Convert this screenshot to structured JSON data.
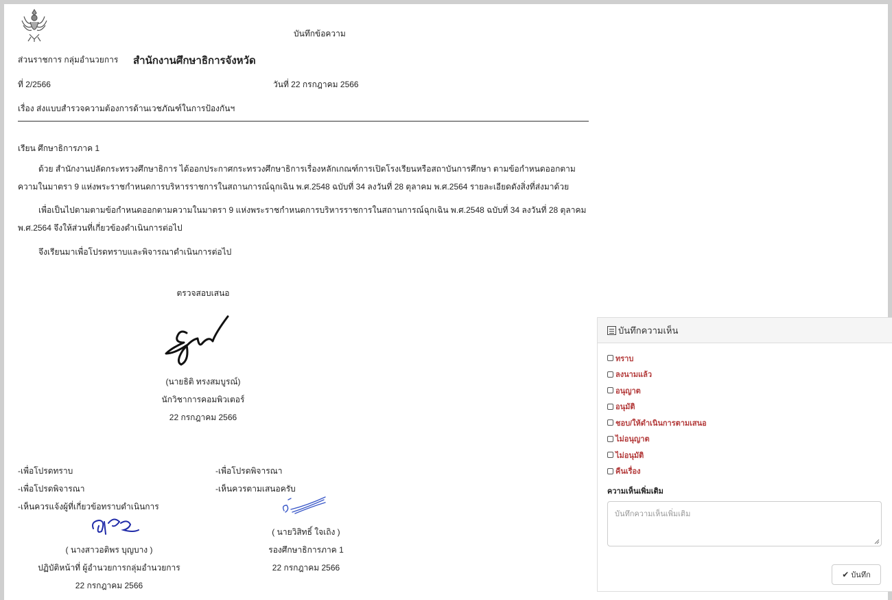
{
  "memo": {
    "title": "บันทึกข้อความ",
    "org_label": "ส่วนราชการ กลุ่มอำนวยการ",
    "org_name": "สำนักงานศึกษาธิการจังหวัด",
    "doc_no": "ที่ 2/2566",
    "doc_date": "วันที่ 22 กรกฎาคม 2566",
    "subject": "เรื่อง ส่งแบบสำรวจความต้องการด้านเวชภัณฑ์ในการป้องกันฯ",
    "to": "เรียน ศึกษาธิการภาค 1",
    "para1": "ด้วย สำนักงานปลัดกระทรวงศึกษาธิการ ได้ออกประกาศกระทรวงศึกษาธิการเรื่องหลักเกณฑ์การเปิดโรงเรียนหรือสถาบันการศึกษา ตามข้อกำหนดออกตามความในมาตรา 9 แห่งพระราชกำหนดการบริหารราชการในสถานการณ์ฉุกเฉิน พ.ศ.2548 ฉบับที่ 34 ลงวันที่ 28 ตุลาคม พ.ศ.2564 รายละเอียดดังสิ่งที่ส่งมาด้วย",
    "para2": "เพื่อเป็นไปตามตามข้อกำหนดออกตามความในมาตรา 9 แห่งพระราชกำหนดการบริหารราชการในสถานการณ์ฉุกเฉิน พ.ศ.2548 ฉบับที่ 34 ลงวันที่ 28 ตุลาคม พ.ศ.2564 จึงให้ส่วนที่เกี่ยวข้องดำเนินการต่อไป",
    "para3": "จึงเรียนมาเพื่อโปรดทราบและพิจารณาดำเนินการต่อไป"
  },
  "signer1": {
    "caption": "ตรวจสอบเสนอ",
    "name": "(นายธิติ ทรงสมบูรณ์)",
    "position": "นักวิชาการคอมพิวเตอร์",
    "date": "22 กรกฎาคม 2566"
  },
  "notes_left": [
    "-เพื่อโปรดทราบ",
    "-เพื่อโปรดพิจารณา",
    "-เห็นควรแจ้งผู้ที่เกี่ยวข้อทราบดำเนินการ"
  ],
  "signer2": {
    "name": "( นางสาวอติพร บุญบาง )",
    "position": "ปฏิบัติหน้าที่ ผู้อำนวยการกลุ่มอำนวยการ",
    "date": "22 กรกฎาคม 2566"
  },
  "notes_mid": [
    "-เพื่อโปรดพิจารณา",
    "-เห็นควรตามเสนอครับ"
  ],
  "signer3": {
    "name": "( นายวิสิทธิ์ ใจเถิง )",
    "position": "รองศึกษาธิการภาค 1",
    "date": "22 กรกฎาคม 2566"
  },
  "panel": {
    "title": "บันทึกความเห็น",
    "icon": "list-alt-icon",
    "options": [
      "ทราบ",
      "ลงนามแล้ว",
      "อนุญาต",
      "อนุมัติ",
      "ชอบ/ให้ดำเนินการตามเสนอ",
      "ไม่อนุญาต",
      "ไม่อนุมัติ",
      "คืนเรื่อง"
    ],
    "extra_label": "ความเห็นเพิ่มเติม",
    "comment_placeholder": "บันทึกความเห็นเพิ่มเติม",
    "save_label": "บันทึก"
  },
  "colors": {
    "option_text": "#b33a3a",
    "panel_header_bg": "#f5f5f5",
    "signature_black": "#111111",
    "signature_blue": "#1f2aa8"
  }
}
